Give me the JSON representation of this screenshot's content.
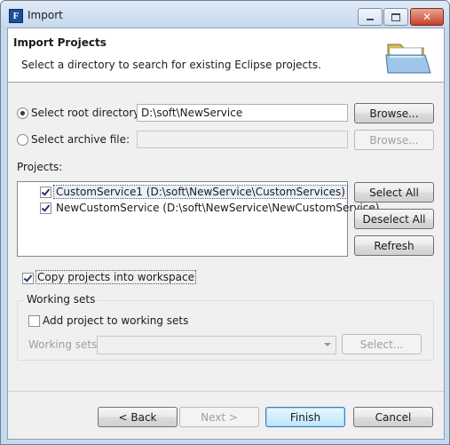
{
  "window": {
    "title": "Import",
    "close_glyph": "✕"
  },
  "header": {
    "title": "Import Projects",
    "description": "Select a directory to search for existing Eclipse projects."
  },
  "root_directory": {
    "label": "Select root directory:",
    "value": "D:\\soft\\NewService",
    "browse_label": "Browse...",
    "selected": true
  },
  "archive_file": {
    "label": "Select archive file:",
    "value": "",
    "browse_label": "Browse...",
    "selected": false
  },
  "projects": {
    "label": "Projects:",
    "items": [
      {
        "label": "CustomService1 (D:\\soft\\NewService\\CustomServices)",
        "checked": true
      },
      {
        "label": "NewCustomService (D:\\soft\\NewService\\NewCustomService)",
        "checked": true
      }
    ],
    "select_all_label": "Select All",
    "deselect_all_label": "Deselect All",
    "refresh_label": "Refresh"
  },
  "copy_projects": {
    "label": "Copy projects into workspace",
    "checked": true
  },
  "working_sets": {
    "group_label": "Working sets",
    "add_label": "Add project to working sets",
    "add_checked": false,
    "field_label": "Working sets:",
    "select_label": "Select..."
  },
  "footer": {
    "back_label": "< Back",
    "next_label": "Next >",
    "finish_label": "Finish",
    "cancel_label": "Cancel"
  },
  "colors": {
    "title_bar": "#c6d9ee",
    "close_button": "#c6412c",
    "dialog_background": "#f0f0f0"
  },
  "icons": [
    "eclipse-app-icon",
    "minimize-icon",
    "maximize-icon",
    "close-icon",
    "open-folder-icon"
  ]
}
